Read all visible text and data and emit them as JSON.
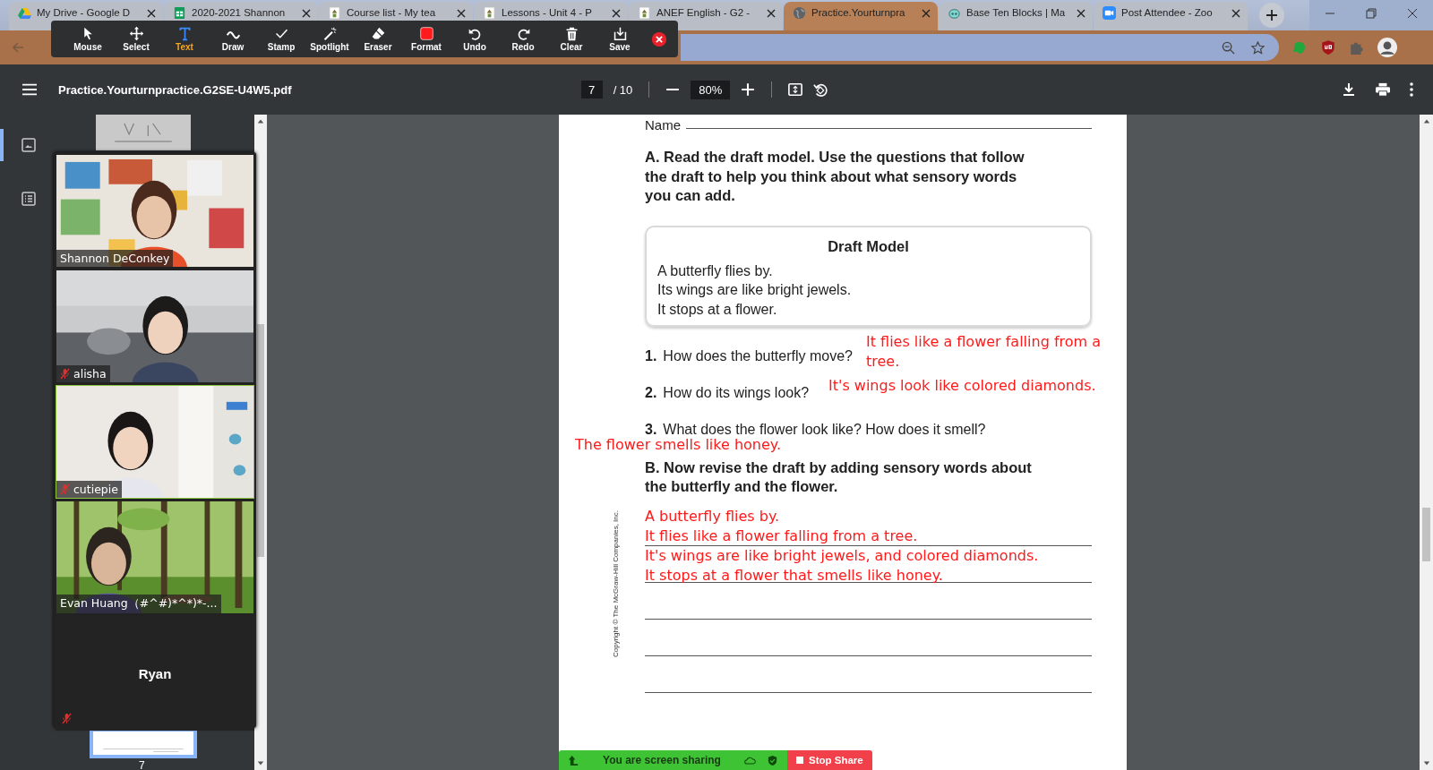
{
  "browser": {
    "tabs": [
      {
        "title": "My Drive - Google D",
        "selected": false
      },
      {
        "title": "2020-2021 Shannon",
        "selected": false
      },
      {
        "title": "Course list - My tea",
        "selected": false
      },
      {
        "title": "Lessons - Unit 4 - P",
        "selected": false
      },
      {
        "title": "ANEF English - G2 -",
        "selected": false
      },
      {
        "title": "Practice.Yourturnpra",
        "selected": true
      },
      {
        "title": "Base Ten Blocks | Ma",
        "selected": false
      },
      {
        "title": "Post Attendee - Zoo",
        "selected": false
      }
    ]
  },
  "annotation_toolbar": {
    "tools": [
      {
        "label": "Mouse",
        "kind": "mouse",
        "selected": false
      },
      {
        "label": "Select",
        "kind": "select",
        "selected": false
      },
      {
        "label": "Text",
        "kind": "text",
        "selected": true
      },
      {
        "label": "Draw",
        "kind": "draw",
        "selected": false
      },
      {
        "label": "Stamp",
        "kind": "stamp",
        "selected": false
      },
      {
        "label": "Spotlight",
        "kind": "spotlight",
        "selected": false
      },
      {
        "label": "Eraser",
        "kind": "eraser",
        "selected": false
      },
      {
        "label": "Format",
        "kind": "format",
        "selected": false
      },
      {
        "label": "Undo",
        "kind": "undo",
        "selected": false
      },
      {
        "label": "Redo",
        "kind": "redo",
        "selected": false
      },
      {
        "label": "Clear",
        "kind": "clear",
        "selected": false
      },
      {
        "label": "Save",
        "kind": "save",
        "selected": false
      }
    ]
  },
  "pdf_toolbar": {
    "title": "Practice.Yourturnpractice.G2SE-U4W5.pdf",
    "page": "7",
    "page_total": "/ 10",
    "zoom": "80%"
  },
  "sidebar": {
    "views": [
      {
        "kind": "thumbnails",
        "selected": true
      },
      {
        "kind": "outline",
        "selected": false
      }
    ],
    "thumbnails": [
      {
        "selected": false
      },
      {
        "label": "7",
        "selected": true
      }
    ]
  },
  "document": {
    "name_label": "Name",
    "instruction_a": "A. Read the draft model. Use the questions that follow the draft to help you think about what sensory words you can add.",
    "draft_model": {
      "title": "Draft Model",
      "lines": [
        "A butterfly flies by.",
        "Its wings are like bright jewels.",
        "It stops at a flower."
      ]
    },
    "questions": [
      {
        "number": "1.",
        "text": "How does the butterfly move?",
        "answer": [
          "It flies like a flower falling from a",
          "tree."
        ]
      },
      {
        "number": "2.",
        "text": "How do its wings look?",
        "answer": [
          "It's wings look like colored diamonds."
        ]
      },
      {
        "number": "3.",
        "text": "What does the flower look like? How does it smell?",
        "answer": [
          "The flower smells like honey."
        ]
      }
    ],
    "instruction_b": "B. Now revise the draft by adding sensory words about the butterfly and the flower.",
    "revision": [
      "A butterfly flies by.",
      "It flies like a flower falling from a tree.",
      "It's wings are like bright jewels, and colored diamonds.",
      "It stops at a flower that smells like honey."
    ],
    "copyright": "Copyright © The McGraw-Hill Companies, Inc."
  },
  "participants": [
    {
      "name": "Shannon DeConkey",
      "muted": false,
      "speaking": false,
      "video": true
    },
    {
      "name": "alisha",
      "muted": true,
      "speaking": false,
      "video": true
    },
    {
      "name": "cutiepie",
      "muted": true,
      "speaking": true,
      "video": true
    },
    {
      "name": "Evan Huang（#^#)*^*)*-...",
      "muted": false,
      "speaking": false,
      "video": true
    },
    {
      "name": "Ryan",
      "muted": true,
      "speaking": false,
      "video": false
    }
  ],
  "share_bar": {
    "status": "You are screen sharing",
    "stop": "Stop Share"
  }
}
